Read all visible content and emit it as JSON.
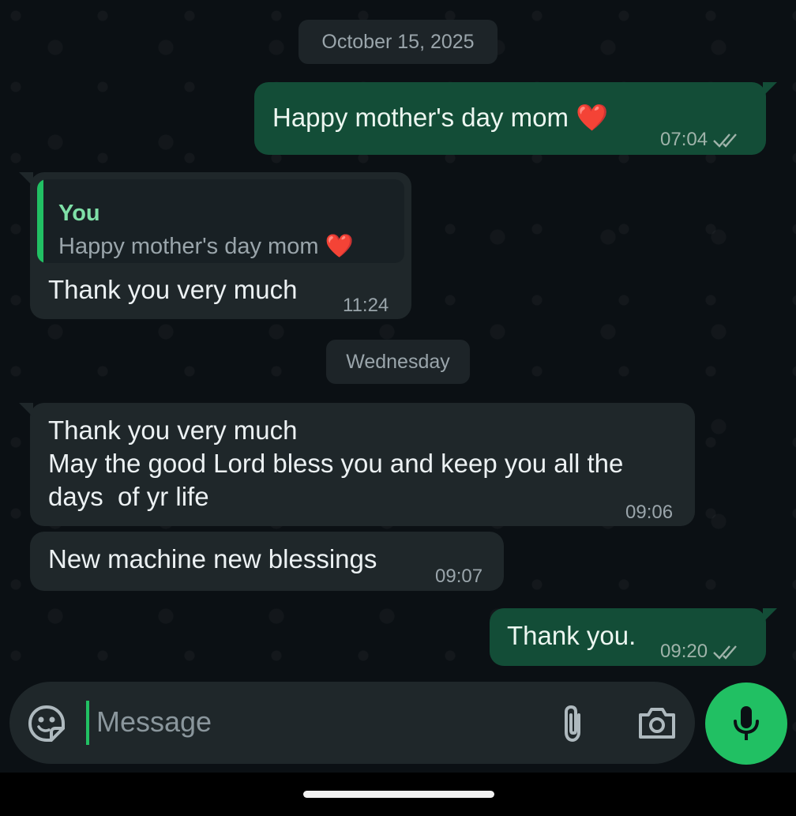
{
  "chat": {
    "date_top": "October 15, 2025",
    "date_mid": "Wednesday",
    "messages": [
      {
        "dir": "out",
        "text": "Happy mother's day mom",
        "emoji": "❤️",
        "time": "07:04",
        "status": "read"
      },
      {
        "dir": "in",
        "quote_author": "You",
        "quote_text": "Happy mother's day mom",
        "quote_emoji": "❤️",
        "text": "Thank you very much",
        "time": "11:24"
      },
      {
        "dir": "in",
        "text_line1": "Thank you very much",
        "text_line2": "May the good Lord bless you and keep you all the",
        "text_line3": "days  of yr life",
        "time": "09:06"
      },
      {
        "dir": "in",
        "text": "New machine new blessings",
        "time": "09:07"
      },
      {
        "dir": "out",
        "text": "Thank you.",
        "time": "09:20",
        "status": "read"
      }
    ]
  },
  "composer": {
    "placeholder": "Message",
    "emoji_icon": "sticker-icon",
    "attach_icon": "paperclip-icon",
    "camera_icon": "camera-icon",
    "mic_icon": "microphone-icon"
  },
  "colors": {
    "background": "#0b1014",
    "outgoing_bubble": "#134d37",
    "incoming_bubble": "#1f272a",
    "accent": "#21c063"
  }
}
